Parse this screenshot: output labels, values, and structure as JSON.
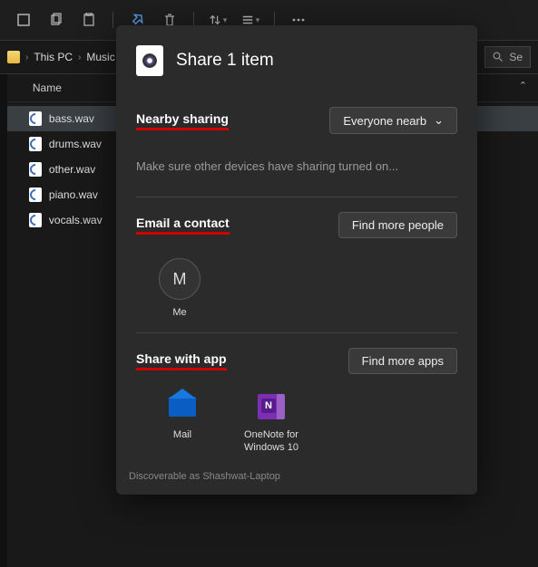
{
  "toolbar": {
    "icons": [
      "copy-icon",
      "paste-icon",
      "rename-icon",
      "share-icon",
      "delete-icon",
      "sort-icon",
      "view-icon",
      "more-icon"
    ]
  },
  "breadcrumb": {
    "root": "This PC",
    "folder": "Music"
  },
  "search": {
    "placeholder": "Se"
  },
  "columns": {
    "name": "Name"
  },
  "files": [
    {
      "name": "bass.wav",
      "selected": true
    },
    {
      "name": "drums.wav",
      "selected": false
    },
    {
      "name": "other.wav",
      "selected": false
    },
    {
      "name": "piano.wav",
      "selected": false
    },
    {
      "name": "vocals.wav",
      "selected": false
    }
  ],
  "share": {
    "title": "Share 1 item",
    "nearby": {
      "label": "Nearby sharing",
      "dropdown": "Everyone nearb",
      "hint": "Make sure other devices have sharing turned on..."
    },
    "email": {
      "label": "Email a contact",
      "button": "Find more people",
      "contacts": [
        {
          "initial": "M",
          "name": "Me"
        }
      ]
    },
    "apps": {
      "label": "Share with app",
      "button": "Find more apps",
      "list": [
        {
          "id": "mail",
          "name": "Mail"
        },
        {
          "id": "onenote",
          "name": "OneNote for Windows 10"
        }
      ]
    },
    "footer": "Discoverable as Shashwat-Laptop"
  }
}
